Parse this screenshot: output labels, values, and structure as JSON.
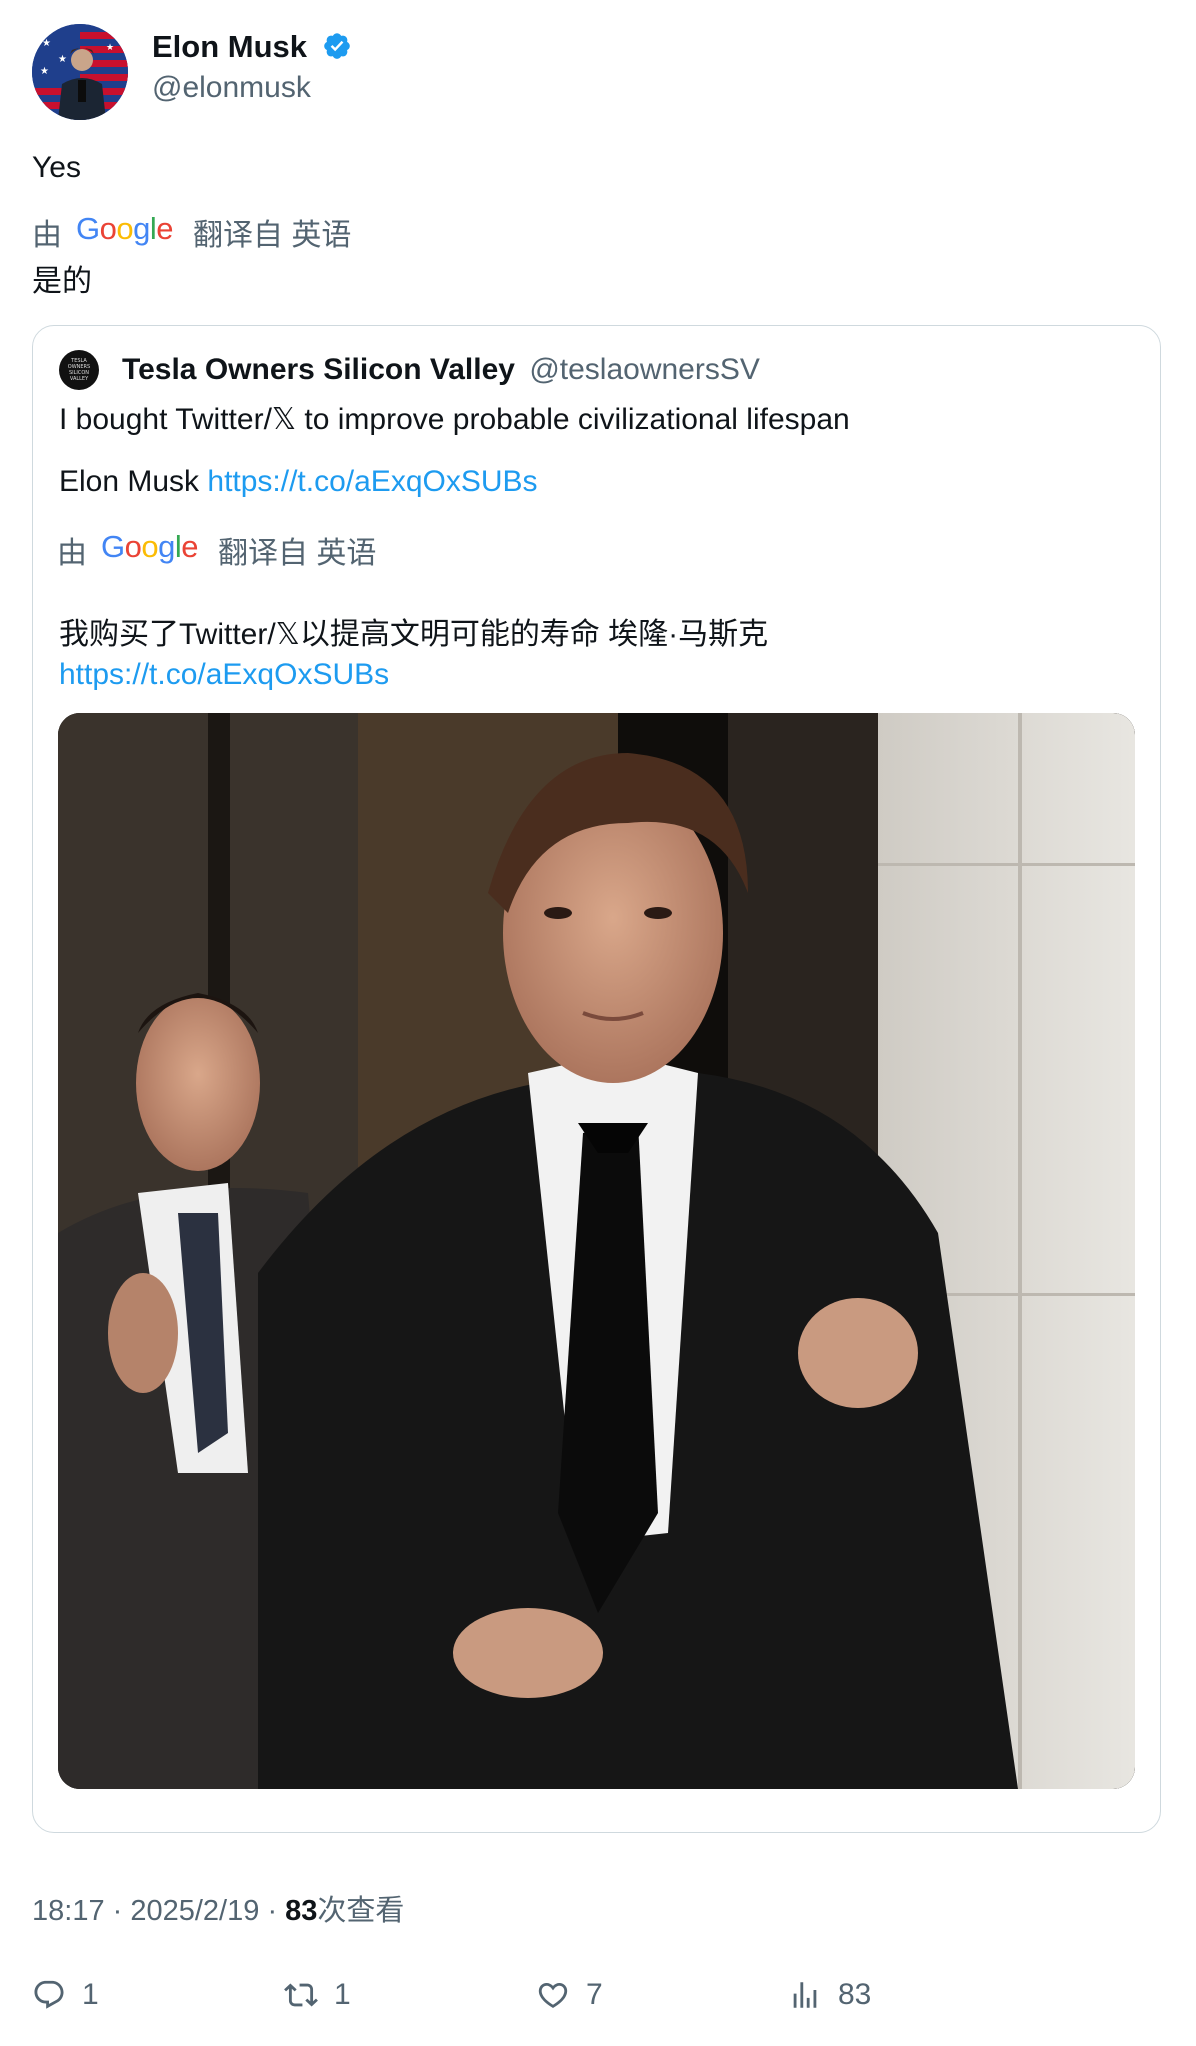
{
  "author": {
    "name": "Elon Musk",
    "handle": "@elonmusk",
    "verified": true
  },
  "tweet": {
    "text": "Yes",
    "translation": {
      "by_label": "由",
      "provider": "Google",
      "from_label": "翻译自 英语",
      "text": "是的"
    }
  },
  "quote": {
    "avatar_text": "TESLA OWNERS SILICON VALLEY",
    "name": "Tesla Owners Silicon Valley",
    "handle": "@teslaownersSV",
    "line1": "I bought Twitter/𝕏 to improve probable civilizational lifespan",
    "line2_prefix": "Elon Musk ",
    "link": "https://t.co/aExqOxSUBs",
    "translation": {
      "by_label": "由",
      "provider": "Google",
      "from_label": "翻译自 英语",
      "text": "我购买了Twitter/𝕏以提高文明可能的寿命 埃隆·马斯克",
      "link": "https://t.co/aExqOxSUBs"
    }
  },
  "meta": {
    "time": "18:17",
    "date": "2025/2/19",
    "views": "83",
    "views_label": "次查看"
  },
  "actions": {
    "replies": "1",
    "retweets": "1",
    "likes": "7",
    "views": "83"
  },
  "colors": {
    "text": "#0f1419",
    "secondary": "#536471",
    "link": "#1d9bf0",
    "border": "#cfd9de",
    "verified": "#1d9bf0"
  }
}
